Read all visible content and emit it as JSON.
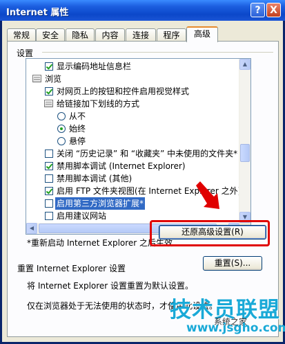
{
  "window": {
    "title": "Internet 属性",
    "help_glyph": "?",
    "close_glyph": "X"
  },
  "tabs": [
    {
      "label": "常规"
    },
    {
      "label": "安全"
    },
    {
      "label": "隐私"
    },
    {
      "label": "内容"
    },
    {
      "label": "连接"
    },
    {
      "label": "程序"
    },
    {
      "label": "高级",
      "active": true
    }
  ],
  "settings": {
    "group_label": "设置",
    "items": [
      {
        "type": "checkbox",
        "checked": true,
        "label": "显示编码地址信息栏"
      },
      {
        "type": "group",
        "label": "浏览"
      },
      {
        "type": "checkbox",
        "checked": true,
        "label": "对网页上的按钮和控件启用视觉样式"
      },
      {
        "type": "group",
        "label": "给链接加下划线的方式"
      },
      {
        "type": "radio",
        "checked": false,
        "label": "从不"
      },
      {
        "type": "radio",
        "checked": true,
        "label": "始终"
      },
      {
        "type": "radio",
        "checked": false,
        "label": "悬停"
      },
      {
        "type": "checkbox",
        "checked": false,
        "label": "关闭 “历史记录” 和 “收藏夹” 中未使用的文件夹*"
      },
      {
        "type": "checkbox",
        "checked": true,
        "label": "禁用脚本调试 (Internet Explorer)"
      },
      {
        "type": "checkbox",
        "checked": false,
        "label": "禁用脚本调试 (其他)"
      },
      {
        "type": "checkbox",
        "checked": true,
        "label": "启用 FTP 文件夹视图(在 Internet Explorer 之外)"
      },
      {
        "type": "checkbox",
        "checked": false,
        "label": "启用第三方浏览器扩展*",
        "selected": true
      },
      {
        "type": "checkbox",
        "checked": false,
        "label": "启用建议网站"
      }
    ]
  },
  "restart_note": "*重新启动 Internet Explorer 之后生效",
  "restore_button": {
    "label": "还原高级设置",
    "mnemonic": "(R)"
  },
  "reset": {
    "title": "重置 Internet Explorer 设置",
    "description": "将 Internet Explorer 设置重置为默认设置。",
    "button_label": "重置",
    "button_mnemonic": "(S)...",
    "warning": "仅在浏览器处于无法使用的状态时，才使用此设置。"
  },
  "watermark": {
    "brand": "技术员联盟",
    "url": "www.jsgho.com",
    "small": "系统之家"
  },
  "colors": {
    "highlight": "#e00000",
    "selection": "#316ac5",
    "tab_accent": "#e68b2c"
  }
}
